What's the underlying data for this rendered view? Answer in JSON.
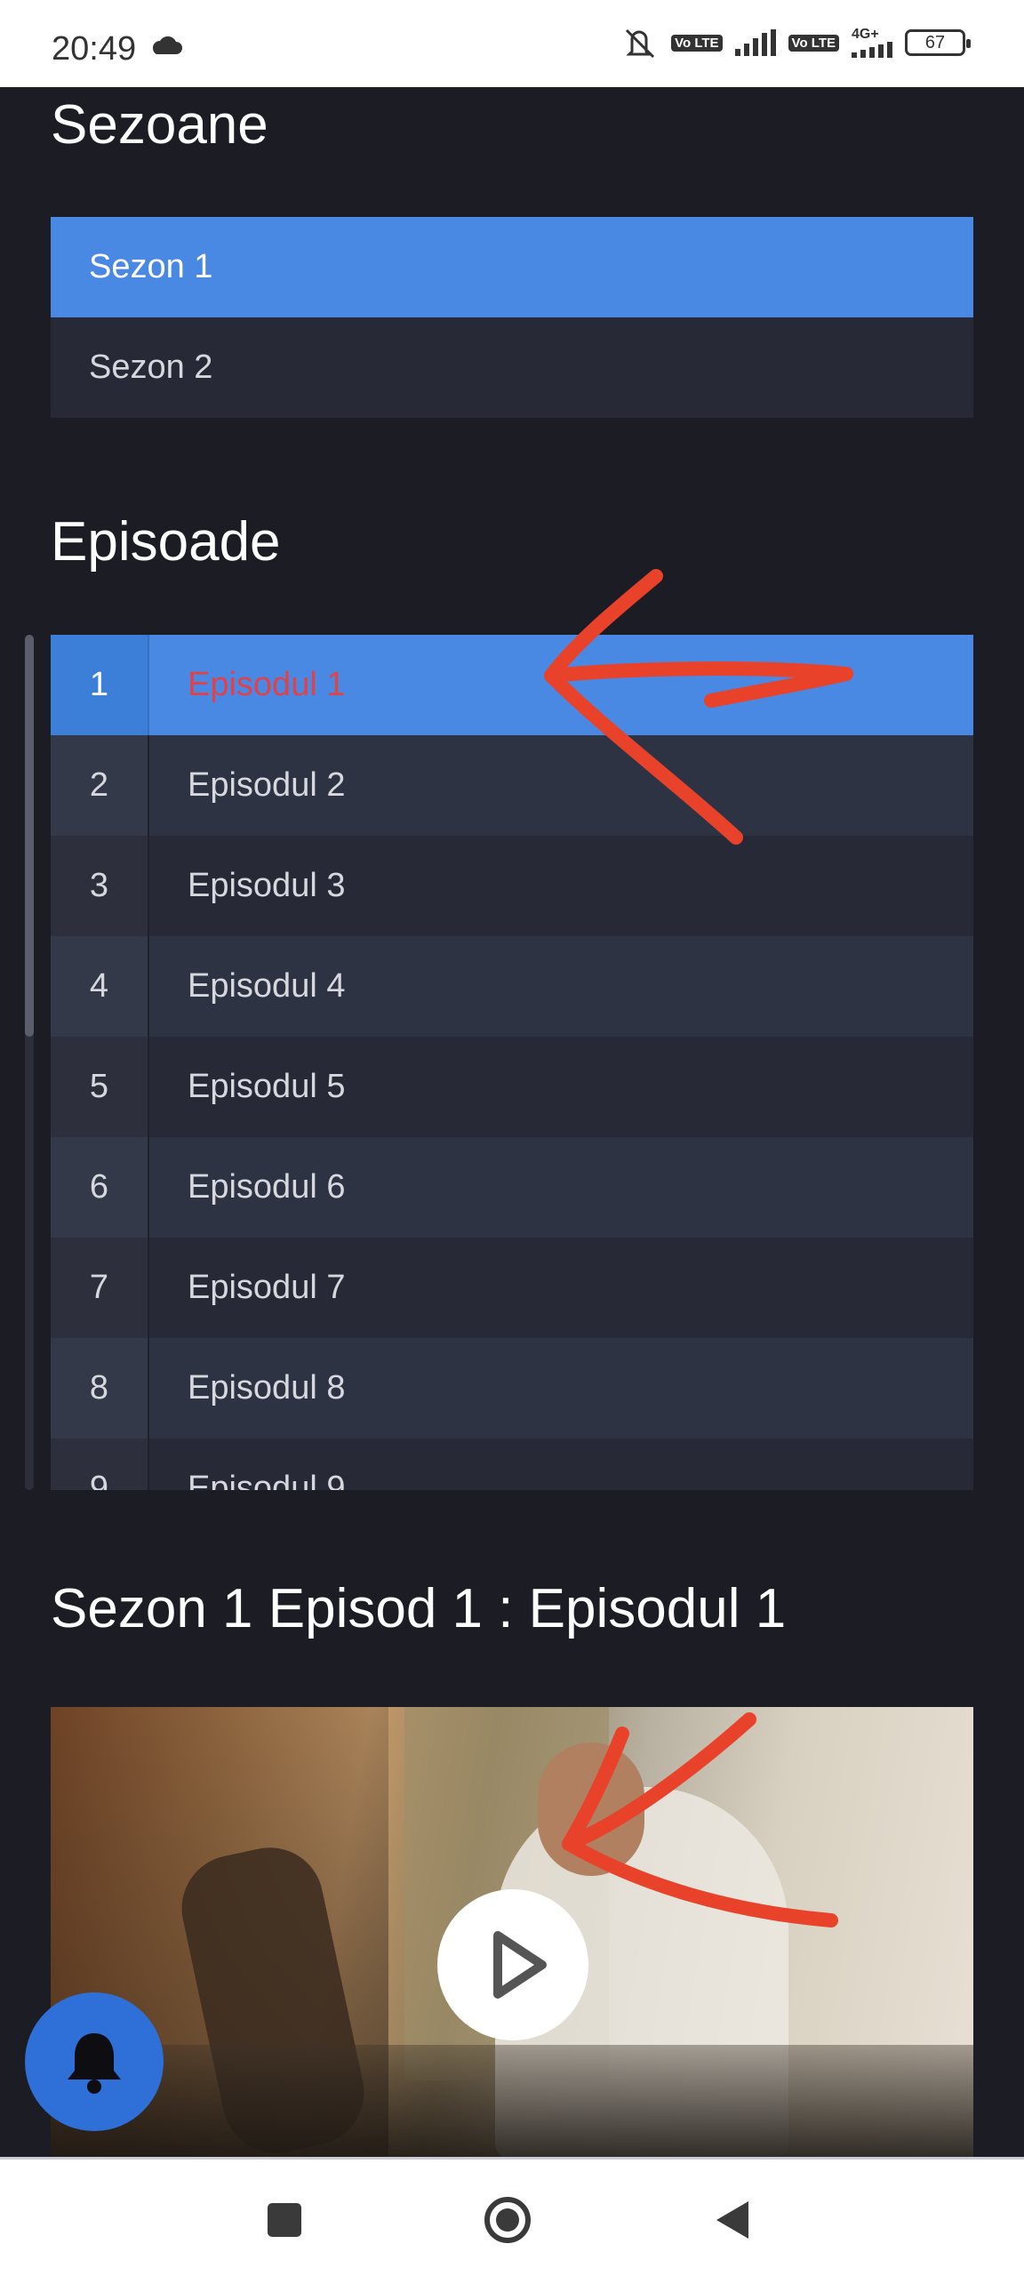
{
  "status_bar": {
    "time": "20:49",
    "volte1": "Vo LTE",
    "volte2": "Vo LTE",
    "network": "4G+",
    "battery": "67"
  },
  "seasons": {
    "heading": "Sezoane",
    "items": [
      {
        "label": "Sezon 1",
        "active": true
      },
      {
        "label": "Sezon 2",
        "active": false
      }
    ]
  },
  "episodes": {
    "heading": "Episoade",
    "items": [
      {
        "num": "1",
        "title": "Episodul 1",
        "active": true
      },
      {
        "num": "2",
        "title": "Episodul 2"
      },
      {
        "num": "3",
        "title": "Episodul 3"
      },
      {
        "num": "4",
        "title": "Episodul 4"
      },
      {
        "num": "5",
        "title": "Episodul 5"
      },
      {
        "num": "6",
        "title": "Episodul 6"
      },
      {
        "num": "7",
        "title": "Episodul 7"
      },
      {
        "num": "8",
        "title": "Episodul 8"
      },
      {
        "num": "9",
        "title": "Episodul 9"
      }
    ]
  },
  "player": {
    "heading": "Sezon 1 Episod 1 : Episodul 1"
  },
  "colors": {
    "background": "#1c1c24",
    "accent": "#4a89e3",
    "active_episode_text": "#e0424a",
    "annotation": "#e8432a",
    "fab": "#2f6fd8"
  },
  "icons": {
    "play": "play-icon",
    "bell": "bell-icon",
    "nav_recent": "square-icon",
    "nav_home": "circle-icon",
    "nav_back": "triangle-back-icon"
  }
}
